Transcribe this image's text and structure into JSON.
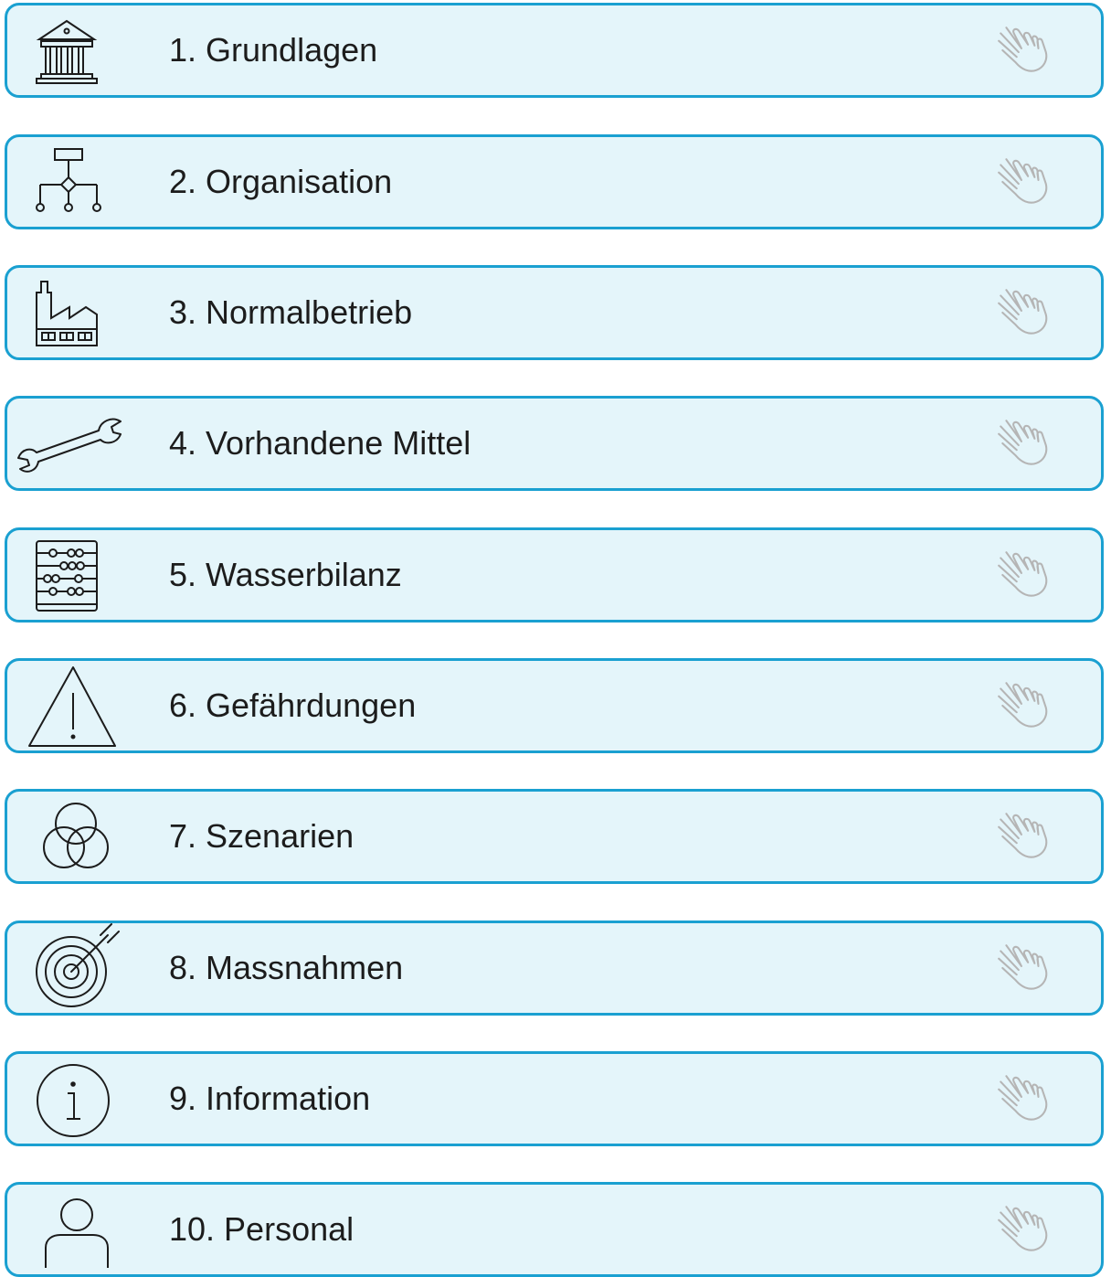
{
  "colors": {
    "card_border": "#1aa0d1",
    "card_background": "#e4f5fa",
    "text": "#1c1c1c",
    "icon_stroke": "#1c1c1c",
    "hand_stroke": "#b5b5b5"
  },
  "menu": {
    "items": [
      {
        "label": "1. Grundlagen",
        "icon": "institution-icon",
        "action_icon": "hand-pointer-icon"
      },
      {
        "label": "2. Organisation",
        "icon": "org-chart-icon",
        "action_icon": "hand-pointer-icon"
      },
      {
        "label": "3. Normalbetrieb",
        "icon": "factory-icon",
        "action_icon": "hand-pointer-icon"
      },
      {
        "label": "4. Vorhandene Mittel",
        "icon": "wrench-icon",
        "action_icon": "hand-pointer-icon"
      },
      {
        "label": "5. Wasserbilanz",
        "icon": "abacus-icon",
        "action_icon": "hand-pointer-icon"
      },
      {
        "label": "6. Gefährdungen",
        "icon": "warning-icon",
        "action_icon": "hand-pointer-icon"
      },
      {
        "label": "7. Szenarien",
        "icon": "venn-diagram-icon",
        "action_icon": "hand-pointer-icon"
      },
      {
        "label": "8. Massnahmen",
        "icon": "target-icon",
        "action_icon": "hand-pointer-icon"
      },
      {
        "label": "9. Information",
        "icon": "info-icon",
        "action_icon": "hand-pointer-icon"
      },
      {
        "label": "10. Personal",
        "icon": "person-icon",
        "action_icon": "hand-pointer-icon"
      }
    ]
  }
}
